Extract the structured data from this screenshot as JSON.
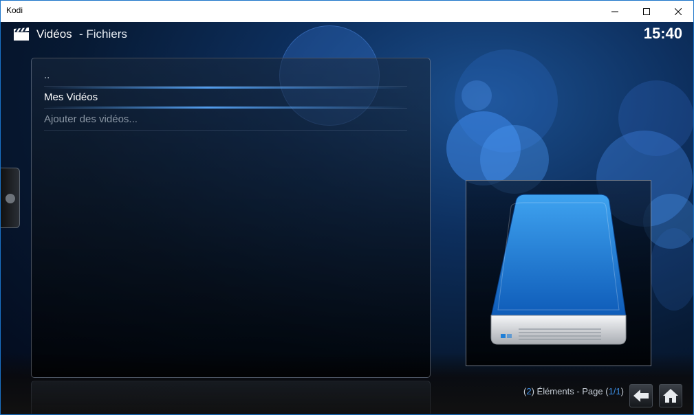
{
  "window": {
    "title": "Kodi"
  },
  "header": {
    "section": "Vidéos",
    "subsection": "- Fichiers",
    "clock": "15:40",
    "icon": "clapperboard-icon"
  },
  "list": {
    "items": [
      {
        "label": ".."
      },
      {
        "label": "Mes Vidéos",
        "focused": true
      },
      {
        "label": "Ajouter des vidéos..."
      }
    ]
  },
  "thumbnail": {
    "icon": "hard-drive-icon"
  },
  "status": {
    "open_paren": "(",
    "count": "2",
    "elements_text": ") Éléments - Page (",
    "page": "1/1",
    "close_paren": ")"
  },
  "controls": {
    "back_icon": "back-arrow-icon",
    "home_icon": "home-icon"
  },
  "colors": {
    "accent": "#3d8fe6",
    "background": "#071a34"
  }
}
